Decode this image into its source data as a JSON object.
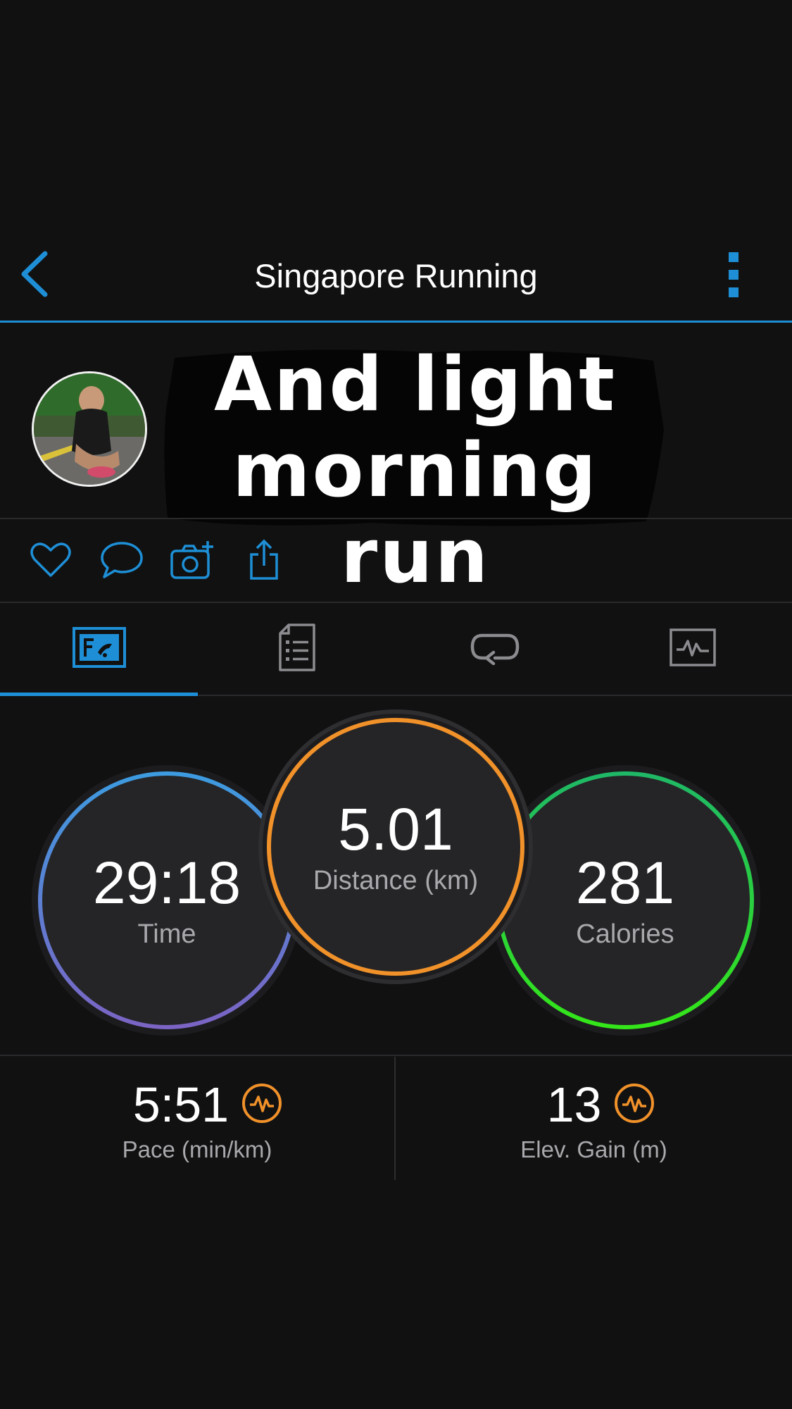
{
  "header": {
    "title": "Singapore Running",
    "back_icon": "chevron-left-icon",
    "more_icon": "more-vertical-icon"
  },
  "activity": {
    "caption": "And light morning run",
    "avatar": "runner-photo"
  },
  "social": {
    "icons": [
      "heart-icon",
      "comment-icon",
      "add-photo-icon",
      "share-icon"
    ]
  },
  "tabs": [
    {
      "icon": "overview-icon",
      "active": true
    },
    {
      "icon": "details-icon",
      "active": false
    },
    {
      "icon": "laps-icon",
      "active": false
    },
    {
      "icon": "chart-icon",
      "active": false
    }
  ],
  "stats": {
    "time": {
      "value": "29:18",
      "label": "Time"
    },
    "distance": {
      "value": "5.01",
      "label": "Distance (km)"
    },
    "calories": {
      "value": "281",
      "label": "Calories"
    }
  },
  "metrics": {
    "pace": {
      "value": "5:51",
      "label": "Pace (min/km)",
      "icon": "pulse-badge-icon"
    },
    "elevation": {
      "value": "13",
      "label": "Elev. Gain (m)",
      "icon": "pulse-badge-icon"
    }
  },
  "colors": {
    "accent": "#1e8fd6",
    "time_ring_start": "#3d9be0",
    "time_ring_end": "#7b64c4",
    "distance_ring": "#f0912a",
    "calories_ring_start": "#1fb866",
    "calories_ring_end": "#34e619",
    "badge": "#f0912a",
    "background": "#111112"
  }
}
